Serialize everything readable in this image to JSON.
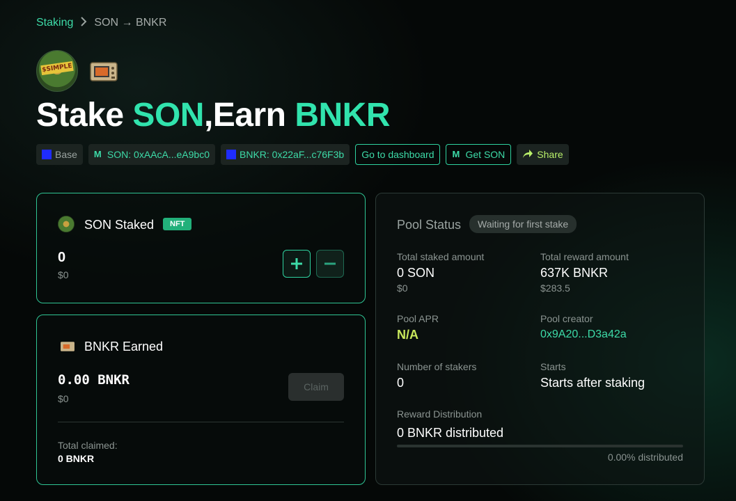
{
  "breadcrumb": {
    "root": "Staking",
    "separator": ">",
    "current": "SON → BNKR"
  },
  "token_a": {
    "logo_text": "$SIMPLE"
  },
  "title": {
    "prefix": "Stake ",
    "stake_token": "SON",
    "comma": ",",
    "earn_word": "Earn ",
    "earn_token": "BNKR"
  },
  "chips": {
    "network": "Base",
    "son_address": "SON: 0xAAcA...eA9bc0",
    "bnkr_address": "BNKR: 0x22aF...c76F3b",
    "dashboard": "Go to dashboard",
    "get_son": "Get SON",
    "share": "Share"
  },
  "staked_card": {
    "title": "SON Staked",
    "badge": "NFT",
    "amount": "0",
    "usd": "$0",
    "plus": "+",
    "minus": "−"
  },
  "earned_card": {
    "title": "BNKR Earned",
    "amount": "0.00 BNKR",
    "usd": "$0",
    "claim": "Claim",
    "total_claimed_label": "Total claimed:",
    "total_claimed_value": "0 BNKR"
  },
  "pool": {
    "title": "Pool Status",
    "status": "Waiting for first stake",
    "total_staked_label": "Total staked amount",
    "total_staked_value": "0 SON",
    "total_staked_usd": "$0",
    "total_reward_label": "Total reward amount",
    "total_reward_value": "637K BNKR",
    "total_reward_usd": "$283.5",
    "apr_label": "Pool APR",
    "apr_value": "N/A",
    "creator_label": "Pool creator",
    "creator_value": "0x9A20...D3a42a",
    "stakers_label": "Number of stakers",
    "stakers_value": "0",
    "starts_label": "Starts",
    "starts_value": "Starts after staking",
    "distribution_label": "Reward Distribution",
    "distribution_value": "0 BNKR distributed",
    "distributed_percent": "0.00% distributed",
    "distributed_fraction": 0
  },
  "colors": {
    "accent": "#31e3ad",
    "lime": "#c9e85c",
    "base_blue": "#1f2cff"
  },
  "icons": {
    "breadcrumb_sep": "chevron-right-icon",
    "mint": "mint-club-icon",
    "share": "share-arrow-icon"
  }
}
